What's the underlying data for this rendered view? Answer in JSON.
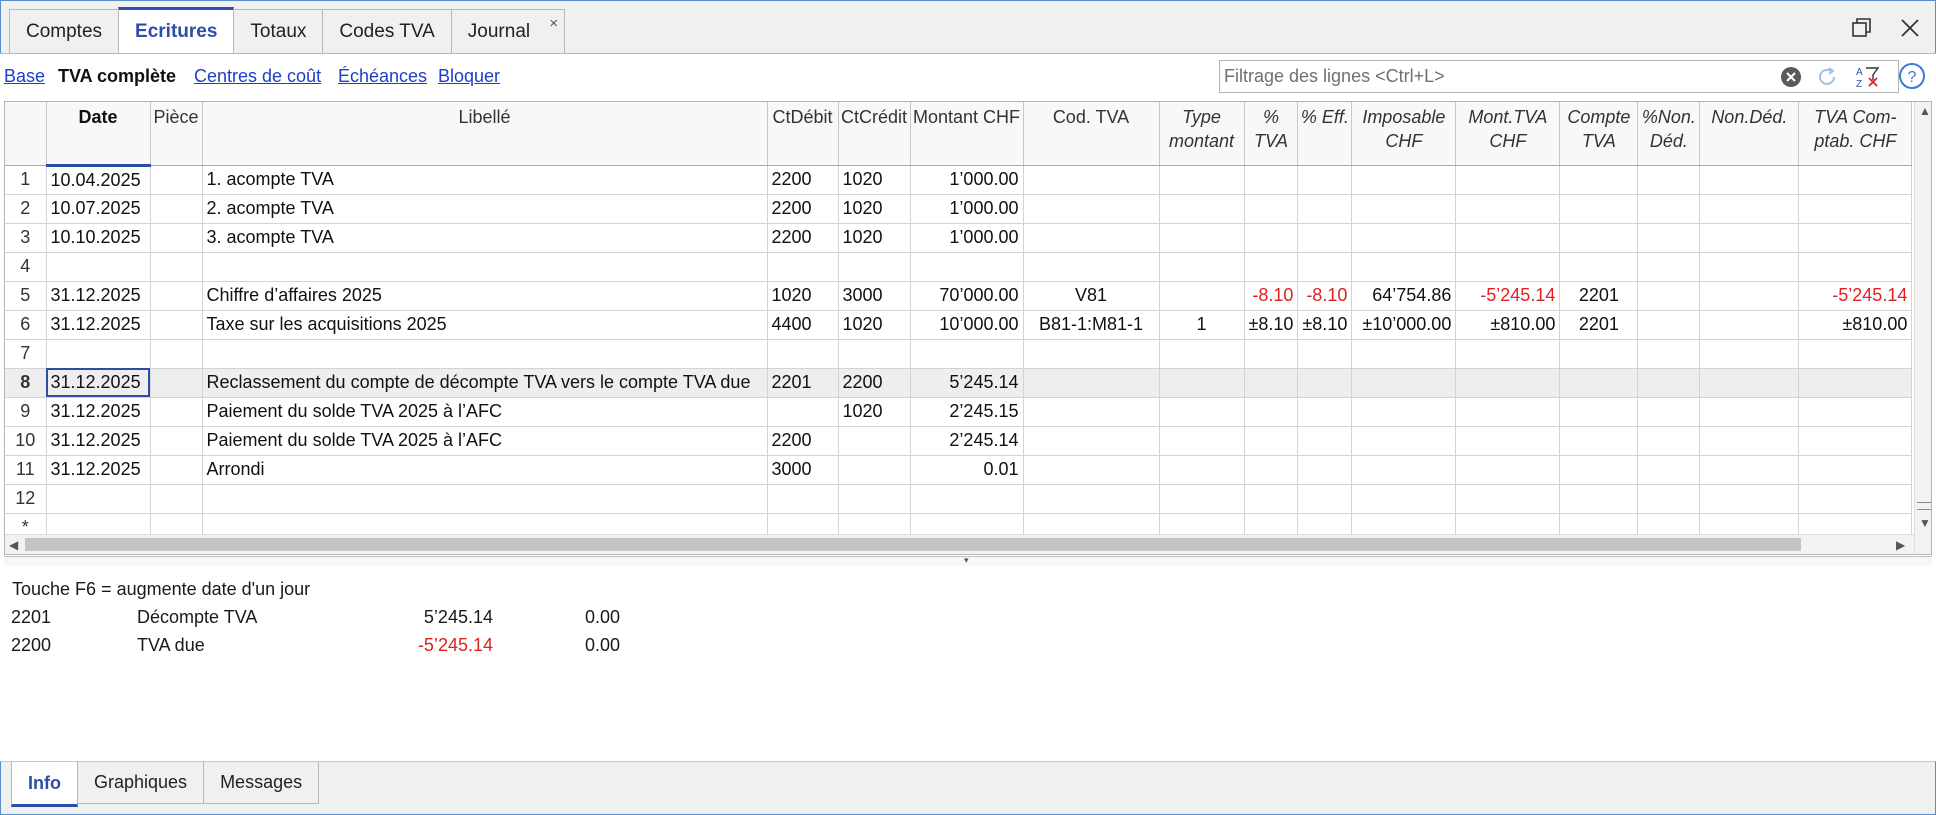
{
  "tabs": [
    {
      "label": "Comptes"
    },
    {
      "label": "Ecritures"
    },
    {
      "label": "Totaux"
    },
    {
      "label": "Codes TVA"
    },
    {
      "label": "Journal"
    }
  ],
  "tab_close_glyph": "×",
  "views": [
    {
      "label": "Base"
    },
    {
      "label": "TVA complète"
    },
    {
      "label": "Centres de coût"
    },
    {
      "label": "Échéances"
    },
    {
      "label": "Bloquer"
    }
  ],
  "filter": {
    "placeholder": "Filtrage des lignes <Ctrl+L>",
    "value": ""
  },
  "grid": {
    "columns": [
      {
        "label": "Date"
      },
      {
        "label": "Pièce"
      },
      {
        "label": "Libellé"
      },
      {
        "label": "CtDébit"
      },
      {
        "label": "CtCrédit"
      },
      {
        "label": "Montant CHF"
      },
      {
        "label": "Cod. TVA"
      },
      {
        "label": "Type",
        "label2": "montant"
      },
      {
        "label": "%",
        "label2": "TVA"
      },
      {
        "label": "% Eff."
      },
      {
        "label": "Imposable",
        "label2": "CHF"
      },
      {
        "label": "Mont.TVA",
        "label2": "CHF"
      },
      {
        "label": "Compte",
        "label2": "TVA"
      },
      {
        "label": "%Non.",
        "label2": "Déd."
      },
      {
        "label": "Non.Déd."
      },
      {
        "label": "TVA Com-",
        "label2": "ptab. CHF"
      }
    ],
    "rows": [
      {
        "num": "1",
        "date": "10.04.2025",
        "piece": "",
        "libelle": "1. acompte TVA",
        "debit": "2200",
        "credit": "1020",
        "montant": "1’000.00",
        "cod_tva": "",
        "type": "",
        "pct_tva": "",
        "pct_eff": "",
        "imposable": "",
        "mont_tva": "",
        "compte_tva": "",
        "pct_non": "",
        "non_ded": "",
        "tva_compt": ""
      },
      {
        "num": "2",
        "date": "10.07.2025",
        "piece": "",
        "libelle": "2. acompte TVA",
        "debit": "2200",
        "credit": "1020",
        "montant": "1’000.00",
        "cod_tva": "",
        "type": "",
        "pct_tva": "",
        "pct_eff": "",
        "imposable": "",
        "mont_tva": "",
        "compte_tva": "",
        "pct_non": "",
        "non_ded": "",
        "tva_compt": ""
      },
      {
        "num": "3",
        "date": "10.10.2025",
        "piece": "",
        "libelle": "3. acompte TVA",
        "debit": "2200",
        "credit": "1020",
        "montant": "1’000.00",
        "cod_tva": "",
        "type": "",
        "pct_tva": "",
        "pct_eff": "",
        "imposable": "",
        "mont_tva": "",
        "compte_tva": "",
        "pct_non": "",
        "non_ded": "",
        "tva_compt": ""
      },
      {
        "num": "4",
        "date": "",
        "piece": "",
        "libelle": "",
        "debit": "",
        "credit": "",
        "montant": "",
        "cod_tva": "",
        "type": "",
        "pct_tva": "",
        "pct_eff": "",
        "imposable": "",
        "mont_tva": "",
        "compte_tva": "",
        "pct_non": "",
        "non_ded": "",
        "tva_compt": ""
      },
      {
        "num": "5",
        "date": "31.12.2025",
        "piece": "",
        "libelle": "Chiffre d’affaires 2025",
        "debit": "1020",
        "credit": "3000",
        "montant": "70’000.00",
        "cod_tva": "V81",
        "type": "",
        "pct_tva": "-8.10",
        "pct_eff": "-8.10",
        "imposable": "64’754.86",
        "mont_tva": "-5’245.14",
        "compte_tva": "2201",
        "pct_non": "",
        "non_ded": "",
        "tva_compt": "-5’245.14"
      },
      {
        "num": "6",
        "date": "31.12.2025",
        "piece": "",
        "libelle": "Taxe sur les acquisitions 2025",
        "debit": "4400",
        "credit": "1020",
        "montant": "10’000.00",
        "cod_tva": "B81-1:M81-1",
        "type": "1",
        "pct_tva": "±8.10",
        "pct_eff": "±8.10",
        "imposable": "±10’000.00",
        "mont_tva": "±810.00",
        "compte_tva": "2201",
        "pct_non": "",
        "non_ded": "",
        "tva_compt": "±810.00"
      },
      {
        "num": "7",
        "date": "",
        "piece": "",
        "libelle": "",
        "debit": "",
        "credit": "",
        "montant": "",
        "cod_tva": "",
        "type": "",
        "pct_tva": "",
        "pct_eff": "",
        "imposable": "",
        "mont_tva": "",
        "compte_tva": "",
        "pct_non": "",
        "non_ded": "",
        "tva_compt": ""
      },
      {
        "num": "8",
        "date": "31.12.2025",
        "piece": "",
        "libelle": "Reclassement du compte de décompte TVA vers le compte TVA due",
        "debit": "2201",
        "credit": "2200",
        "montant": "5’245.14",
        "cod_tva": "",
        "type": "",
        "pct_tva": "",
        "pct_eff": "",
        "imposable": "",
        "mont_tva": "",
        "compte_tva": "",
        "pct_non": "",
        "non_ded": "",
        "tva_compt": ""
      },
      {
        "num": "9",
        "date": "31.12.2025",
        "piece": "",
        "libelle": "Paiement du solde TVA 2025 à l’AFC",
        "debit": "",
        "credit": "1020",
        "montant": "2’245.15",
        "cod_tva": "",
        "type": "",
        "pct_tva": "",
        "pct_eff": "",
        "imposable": "",
        "mont_tva": "",
        "compte_tva": "",
        "pct_non": "",
        "non_ded": "",
        "tva_compt": ""
      },
      {
        "num": "10",
        "date": "31.12.2025",
        "piece": "",
        "libelle": "Paiement du solde TVA 2025 à l’AFC",
        "debit": "2200",
        "credit": "",
        "montant": "2’245.14",
        "cod_tva": "",
        "type": "",
        "pct_tva": "",
        "pct_eff": "",
        "imposable": "",
        "mont_tva": "",
        "compte_tva": "",
        "pct_non": "",
        "non_ded": "",
        "tva_compt": ""
      },
      {
        "num": "11",
        "date": "31.12.2025",
        "piece": "",
        "libelle": "Arrondi",
        "debit": "3000",
        "credit": "",
        "montant": "0.01",
        "cod_tva": "",
        "type": "",
        "pct_tva": "",
        "pct_eff": "",
        "imposable": "",
        "mont_tva": "",
        "compte_tva": "",
        "pct_non": "",
        "non_ded": "",
        "tva_compt": ""
      },
      {
        "num": "12",
        "date": "",
        "piece": "",
        "libelle": "",
        "debit": "",
        "credit": "",
        "montant": "",
        "cod_tva": "",
        "type": "",
        "pct_tva": "",
        "pct_eff": "",
        "imposable": "",
        "mont_tva": "",
        "compte_tva": "",
        "pct_non": "",
        "non_ded": "",
        "tva_compt": ""
      },
      {
        "num": "*",
        "date": "",
        "piece": "",
        "libelle": "",
        "debit": "",
        "credit": "",
        "montant": "",
        "cod_tva": "",
        "type": "",
        "pct_tva": "",
        "pct_eff": "",
        "imposable": "",
        "mont_tva": "",
        "compte_tva": "",
        "pct_non": "",
        "non_ded": "",
        "tva_compt": ""
      }
    ],
    "selected_row": "8",
    "negative_color": "#e02020"
  },
  "info": {
    "message": "Touche F6 = augmente date d'un jour",
    "accounts": [
      {
        "account": "2201",
        "name": "Décompte TVA",
        "amount": "5’245.14",
        "amount2": "0.00",
        "negative": false
      },
      {
        "account": "2200",
        "name": "TVA due",
        "amount": "-5’245.14",
        "amount2": "0.00",
        "negative": true
      }
    ]
  },
  "bottom_tabs": [
    {
      "label": "Info"
    },
    {
      "label": "Graphiques"
    },
    {
      "label": "Messages"
    }
  ],
  "colors": {
    "accent": "#2d4ea6",
    "link": "#1d3ec8",
    "negative": "#e02020"
  }
}
